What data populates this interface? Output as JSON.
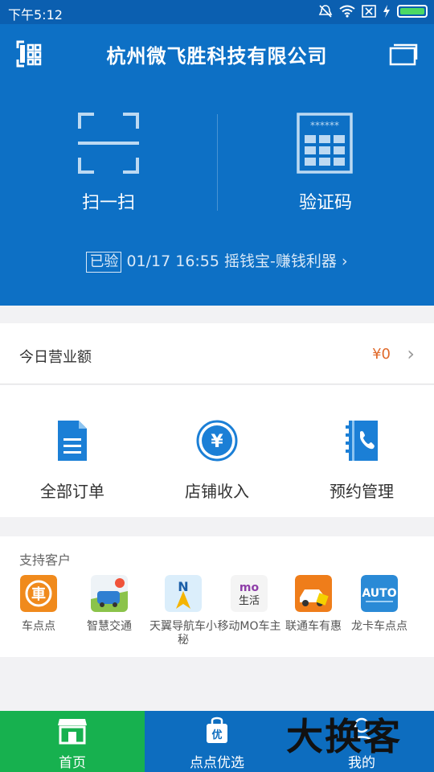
{
  "status_bar": {
    "time": "下午5:12"
  },
  "header": {
    "title": "杭州微飞胜科技有限公司"
  },
  "hero": {
    "scan_label": "扫一扫",
    "code_label": "验证码",
    "code_mask": "******",
    "verify_tag": "已验",
    "verify_text": "01/17 16:55 摇钱宝-赚钱利器",
    "verify_arrow": "›"
  },
  "revenue": {
    "label": "今日营业额",
    "value": "¥0",
    "arrow": "›"
  },
  "shortcuts": [
    {
      "label": "全部订单"
    },
    {
      "label": "店铺收入"
    },
    {
      "label": "预约管理"
    }
  ],
  "partners": {
    "heading": "支持客户",
    "items": [
      {
        "name": "车点点"
      },
      {
        "name": "智慧交通"
      },
      {
        "name": "天翼导航车小秘"
      },
      {
        "name": "移动MO车主"
      },
      {
        "name": "联通车有惠"
      },
      {
        "name": "龙卡车点点"
      }
    ]
  },
  "bottom_nav": [
    {
      "label": "首页"
    },
    {
      "label": "点点优选"
    },
    {
      "label": "我的"
    }
  ],
  "watermark": "大换客",
  "colors": {
    "primary": "#0d70c5",
    "active_tab": "#17b14f",
    "price": "#e0692a"
  }
}
